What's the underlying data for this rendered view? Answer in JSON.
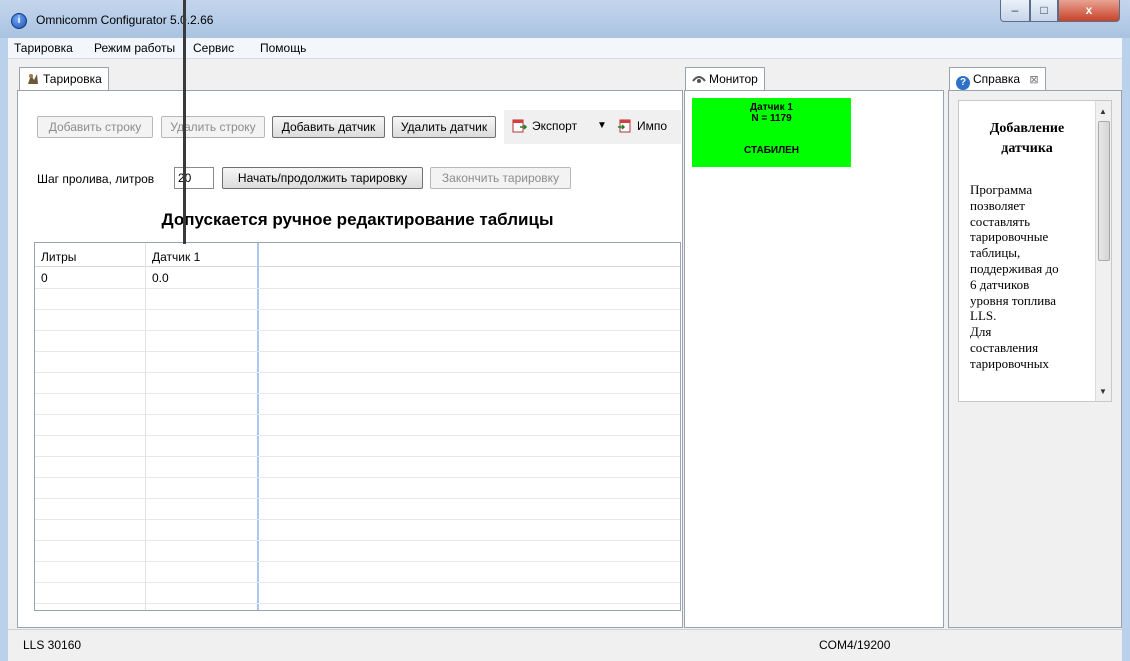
{
  "window": {
    "title": "Omnicomm Configurator 5.0.2.66",
    "controls": {
      "minimize": "–",
      "maximize": "□",
      "close": "x"
    }
  },
  "menu": [
    "Тарировка",
    "Режим работы",
    "Сервис",
    "Помощь"
  ],
  "calibration": {
    "tab_label": "Тарировка",
    "toolbar": {
      "add_row": "Добавить строку",
      "delete_row": "Удалить строку",
      "add_sensor": "Добавить датчик",
      "delete_sensor": "Удалить датчик",
      "export": "Экспорт",
      "import": "Импо"
    },
    "step_label": "Шаг пролива, литров",
    "step_value": "20",
    "start_button": "Начать/продолжить тарировку",
    "finish_button": "Закончить тарировку",
    "notice": "Допускается ручное редактирование таблицы",
    "table": {
      "columns": [
        "Литры",
        "Датчик 1"
      ],
      "rows": [
        [
          "0",
          "0.0"
        ]
      ]
    }
  },
  "monitor": {
    "tab_label": "Монитор",
    "sensor_name": "Датчик 1",
    "sensor_value": "N = 1179",
    "sensor_status": "СТАБИЛЕН",
    "tile_color": "#00ff00"
  },
  "help": {
    "tab_label": "Справка",
    "heading": "Добавление датчика",
    "body_lines": [
      "Программа",
      "позволяет",
      "составлять",
      "тарировочные",
      "таблицы,",
      "поддерживая до",
      "6 датчиков",
      "уровня топлива",
      "LLS.",
      "Для",
      "составления",
      "тарировочных"
    ]
  },
  "status": {
    "device": "LLS 30160",
    "port": "COM4/19200"
  }
}
